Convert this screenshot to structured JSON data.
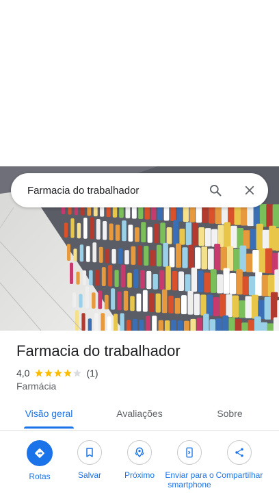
{
  "search": {
    "query": "Farmacia do trabalhador"
  },
  "place": {
    "name": "Farmacia do trabalhador",
    "rating": "4,0",
    "rating_value": 4.0,
    "review_count": "(1)",
    "category": "Farmácia"
  },
  "tabs": [
    {
      "label": "Visão geral"
    },
    {
      "label": "Avaliações"
    },
    {
      "label": "Sobre"
    }
  ],
  "actions": [
    {
      "label": "Rotas",
      "icon": "directions-icon"
    },
    {
      "label": "Salvar",
      "icon": "bookmark-icon"
    },
    {
      "label": "Próximo",
      "icon": "nearby-icon"
    },
    {
      "label": "Enviar para o smartphone",
      "icon": "send-to-phone-icon"
    },
    {
      "label": "Compartilhar",
      "icon": "share-icon"
    }
  ],
  "colors": {
    "accent": "#1a73e8",
    "star": "#fbbc04",
    "star_empty": "#dadce0"
  }
}
